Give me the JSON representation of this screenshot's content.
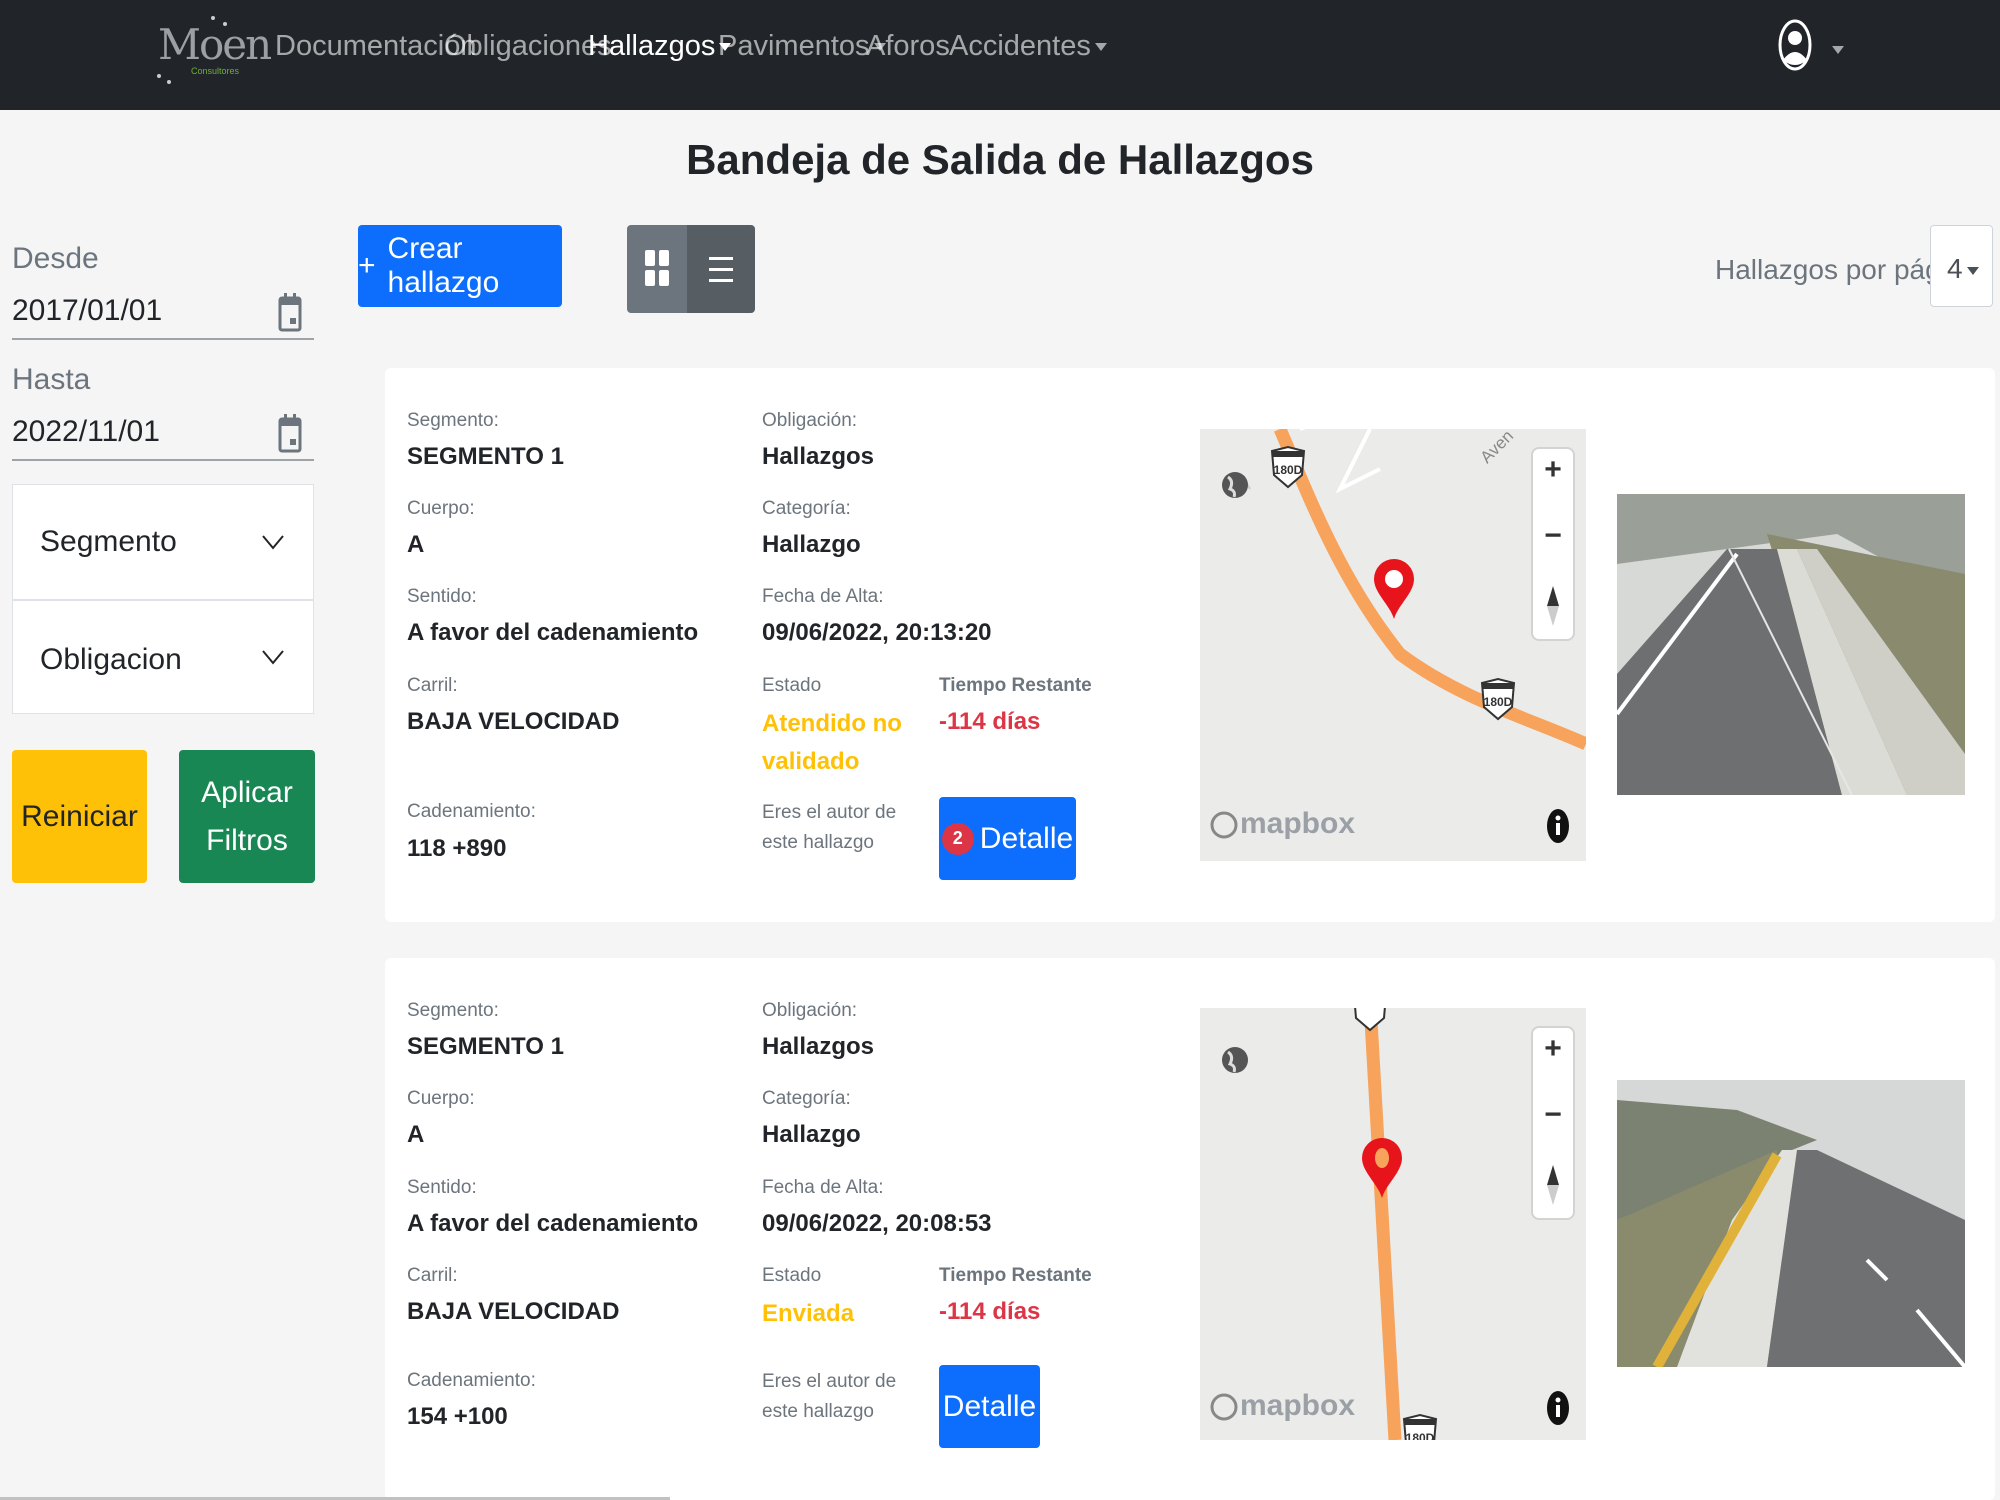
{
  "brand": {
    "name": "Moen",
    "tagline": "Consultores"
  },
  "nav": {
    "items": [
      {
        "label": "Documentación"
      },
      {
        "label": "Obligaciones"
      },
      {
        "label": "Hallazgos"
      },
      {
        "label": "Pavimentos"
      },
      {
        "label": "Aforos"
      },
      {
        "label": "Accidentes"
      }
    ]
  },
  "page": {
    "title": "Bandeja de Salida de Hallazgos"
  },
  "filters": {
    "from_label": "Desde",
    "from_value": "2017/01/01",
    "to_label": "Hasta",
    "to_value": "2022/11/01",
    "segment_label": "Segmento",
    "obligation_label": "Obligacion",
    "reset_label": "Reiniciar",
    "apply_label": "Aplicar Filtros"
  },
  "toolbar": {
    "create_label": "Crear hallazgo",
    "per_page_label": "Hallazgos por página:",
    "per_page_value": "4"
  },
  "labels": {
    "segment": "Segmento:",
    "body": "Cuerpo:",
    "direction": "Sentido:",
    "lane": "Carril:",
    "chainage": "Cadenamiento:",
    "obligation": "Obligación:",
    "category": "Categoría:",
    "created": "Fecha de Alta:",
    "status": "Estado",
    "remaining": "Tiempo Restante",
    "author_note": "Eres el autor de este hallazgo",
    "detail": "Detalle",
    "map_brand": "mapbox"
  },
  "cards": [
    {
      "segment": "SEGMENTO 1",
      "body": "A",
      "direction": "A favor del cadenamiento",
      "lane": "BAJA VELOCIDAD",
      "chainage": "118 +890",
      "obligation": "Hallazgos",
      "category": "Hallazgo",
      "created": "09/06/2022, 20:13:20",
      "status": "Atendido no validado",
      "remaining": "-114 días",
      "badge": "2",
      "map_shields": [
        "180D",
        "180D"
      ],
      "map_street": "Aven"
    },
    {
      "segment": "SEGMENTO 1",
      "body": "A",
      "direction": "A favor del cadenamiento",
      "lane": "BAJA VELOCIDAD",
      "chainage": "154 +100",
      "obligation": "Hallazgos",
      "category": "Hallazgo",
      "created": "09/06/2022, 20:08:53",
      "status": "Enviada",
      "remaining": "-114 días",
      "map_shields": [
        "180D"
      ]
    }
  ],
  "colors": {
    "navbar": "#212529",
    "primary": "#0d6efd",
    "warning": "#ffc107",
    "success": "#198754",
    "danger": "#dc3545",
    "route": "#f7a35c",
    "pin": "#e8141c"
  }
}
